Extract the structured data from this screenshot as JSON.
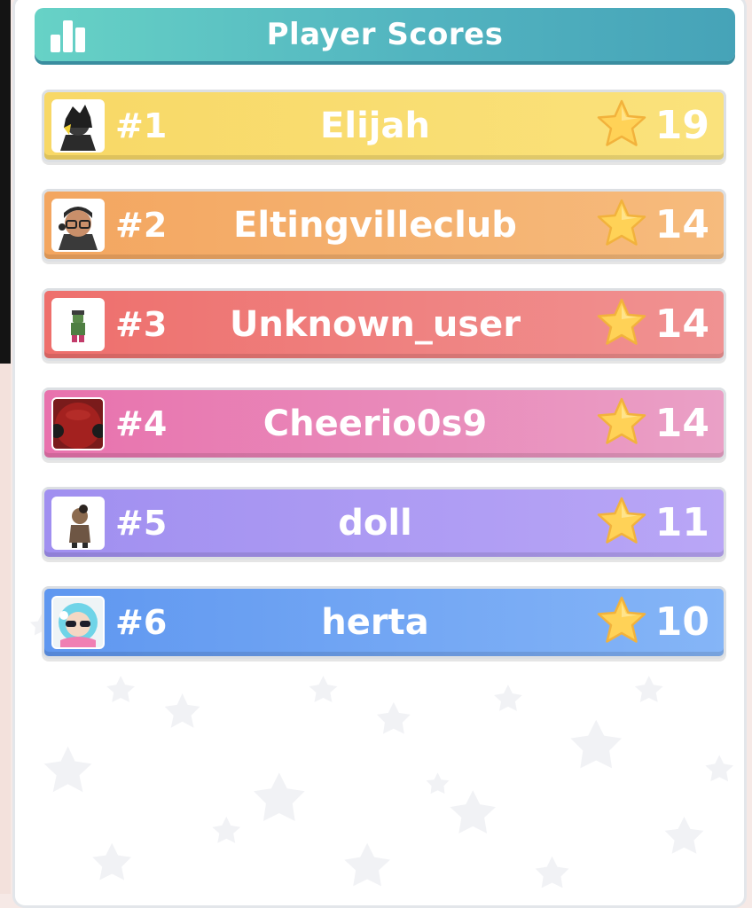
{
  "header": {
    "title": "Player Scores",
    "icon": "bar-chart-icon",
    "colors": [
      "#67d2c6",
      "#46a3b8"
    ]
  },
  "players": [
    {
      "rank": "#1",
      "name": "Elijah",
      "score": "19",
      "colors": [
        "#f8d866",
        "#f9e27a"
      ]
    },
    {
      "rank": "#2",
      "name": "Eltingvilleclub",
      "score": "14",
      "colors": [
        "#f3a660",
        "#f6bb7d"
      ]
    },
    {
      "rank": "#3",
      "name": "Unknown_user",
      "score": "14",
      "colors": [
        "#ee6f6c",
        "#f09292"
      ]
    },
    {
      "rank": "#4",
      "name": "Cheerio0s9",
      "score": "14",
      "colors": [
        "#e872ad",
        "#eaa0c6"
      ]
    },
    {
      "rank": "#5",
      "name": "doll",
      "score": "11",
      "colors": [
        "#a08ff0",
        "#b9a6f6"
      ]
    },
    {
      "rank": "#6",
      "name": "herta",
      "score": "10",
      "colors": [
        "#5f97f0",
        "#85b5f7"
      ]
    }
  ],
  "score_icon": "star-icon"
}
